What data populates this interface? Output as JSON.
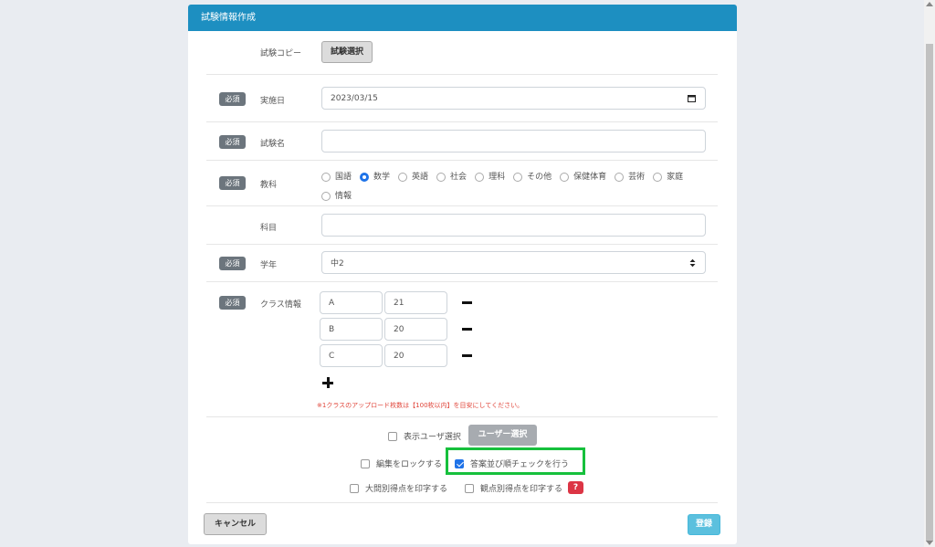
{
  "modal": {
    "title": "試験情報作成"
  },
  "required_badge": "必須",
  "exam_copy": {
    "label": "試験コピー",
    "button": "試験選択"
  },
  "date": {
    "label": "実施日",
    "value": "2023/03/15"
  },
  "exam_name": {
    "label": "試験名",
    "value": ""
  },
  "subject": {
    "label": "教科",
    "options": [
      "国語",
      "数学",
      "英語",
      "社会",
      "理科",
      "その他",
      "保健体育",
      "芸術",
      "家庭",
      "情報"
    ],
    "selected": "数学"
  },
  "course": {
    "label": "科目",
    "value": ""
  },
  "grade": {
    "label": "学年",
    "value": "中2"
  },
  "class_info": {
    "label": "クラス情報",
    "rows": [
      {
        "name": "A",
        "count": "21"
      },
      {
        "name": "B",
        "count": "20"
      },
      {
        "name": "C",
        "count": "20"
      }
    ],
    "note": "※1クラスのアップロード枚数は【100枚以内】を目安にしてください。"
  },
  "options": {
    "display_user": {
      "label": "表示ユーザ選択",
      "checked": false
    },
    "user_select_button": "ユーザー選択",
    "lock_edit": {
      "label": "編集をロックする",
      "checked": false
    },
    "answer_order_check": {
      "label": "答案並び順チェックを行う",
      "checked": true
    },
    "print_question_scores": {
      "label": "大問別得点を印字する",
      "checked": false
    },
    "print_viewpoint_scores": {
      "label": "観点別得点を印字する",
      "checked": false
    },
    "help_badge": "?"
  },
  "footer": {
    "cancel": "キャンセル",
    "register": "登録"
  },
  "colors": {
    "header": "#1d8fc1",
    "highlight": "#16c03c",
    "register": "#5bc0de",
    "help": "#dc3545"
  }
}
